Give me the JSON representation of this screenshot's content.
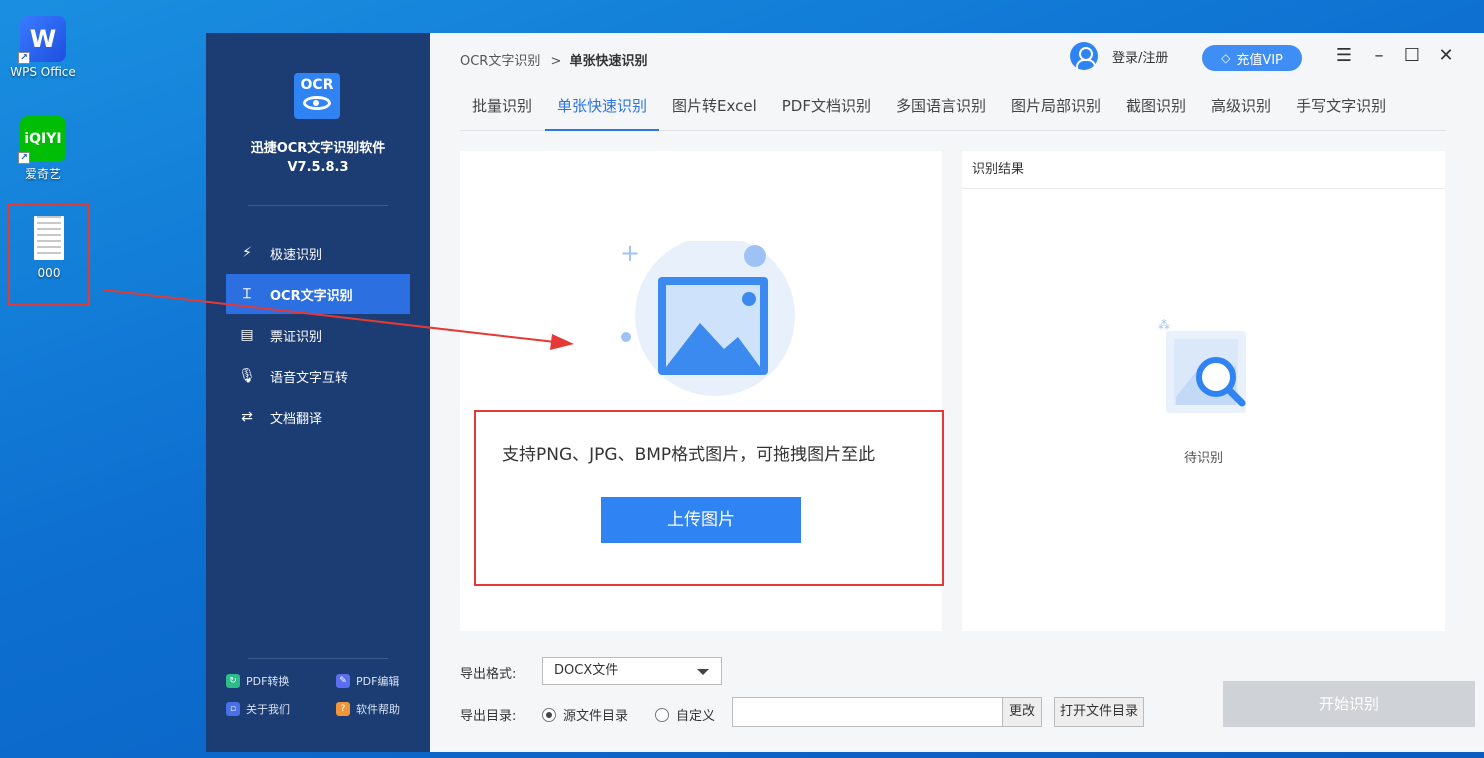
{
  "desktop": {
    "icons": [
      {
        "label": "WPS Office"
      },
      {
        "label": "爱奇艺",
        "badge": "iQIYI"
      },
      {
        "label": "000"
      }
    ]
  },
  "sidebar": {
    "logo_text": "OCR",
    "app_name": "迅捷OCR文字识别软件",
    "version": "V7.5.8.3",
    "nav": [
      {
        "label": "极速识别",
        "icon": "lightning-doc-icon"
      },
      {
        "label": "OCR文字识别",
        "icon": "text-scan-icon",
        "active": true
      },
      {
        "label": "票证识别",
        "icon": "ticket-icon"
      },
      {
        "label": "语音文字互转",
        "icon": "microphone-icon"
      },
      {
        "label": "文档翻译",
        "icon": "translate-doc-icon"
      }
    ],
    "footer": [
      {
        "label": "PDF转换",
        "color": "#2ebd8a"
      },
      {
        "label": "PDF编辑",
        "color": "#5b6df0"
      },
      {
        "label": "关于我们",
        "color": "#4a70e8"
      },
      {
        "label": "软件帮助",
        "color": "#f0953a"
      }
    ]
  },
  "header": {
    "breadcrumb_root": "OCR文字识别",
    "breadcrumb_sep": ">",
    "breadcrumb_current": "单张快速识别",
    "login_label": "登录/注册",
    "vip_label": "充值VIP"
  },
  "tabs": [
    {
      "label": "批量识别"
    },
    {
      "label": "单张快速识别",
      "active": true
    },
    {
      "label": "图片转Excel"
    },
    {
      "label": "PDF文档识别"
    },
    {
      "label": "多国语言识别"
    },
    {
      "label": "图片局部识别"
    },
    {
      "label": "截图识别"
    },
    {
      "label": "高级识别"
    },
    {
      "label": "手写文字识别"
    }
  ],
  "upload": {
    "support_text": "支持PNG、JPG、BMP格式图片，可拖拽图片至此",
    "button_label": "上传图片"
  },
  "result": {
    "header": "识别结果",
    "status": "待识别"
  },
  "export": {
    "format_label": "导出格式:",
    "format_value": "DOCX文件",
    "dir_label": "导出目录:",
    "radio_source": "源文件目录",
    "radio_custom": "自定义",
    "path_value": "",
    "change_label": "更改",
    "open_dir_label": "打开文件目录",
    "start_label": "开始识别"
  },
  "colors": {
    "sidebar_bg": "#1c3d74",
    "accent": "#2f83f2",
    "highlight_border": "#e53935"
  }
}
